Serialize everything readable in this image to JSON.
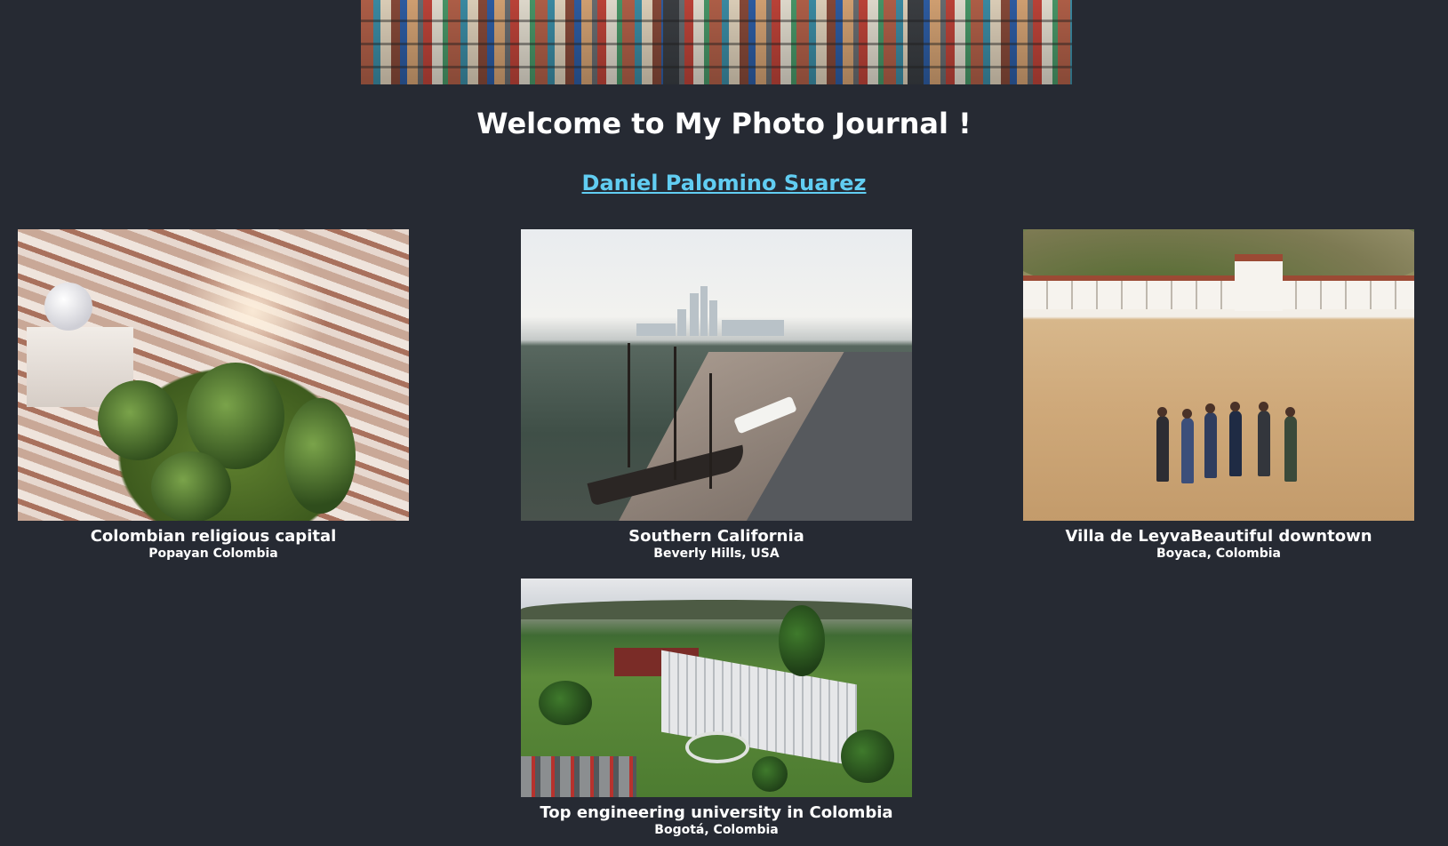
{
  "header": {
    "title": "Welcome to My Photo Journal !",
    "author_link": "Daniel Palomino Suarez"
  },
  "photos": [
    {
      "caption": "Colombian religious capital",
      "location": "Popayan Colombia"
    },
    {
      "caption": "Southern California",
      "location": "Beverly Hills, USA"
    },
    {
      "caption": "Villa de LeyvaBeautiful downtown",
      "location": "Boyaca, Colombia"
    },
    {
      "caption": "Top engineering university in Colombia",
      "location": "Bogotá, Colombia"
    }
  ],
  "colors": {
    "background": "#262a33",
    "text": "#ffffff",
    "link": "#61cdf2"
  }
}
